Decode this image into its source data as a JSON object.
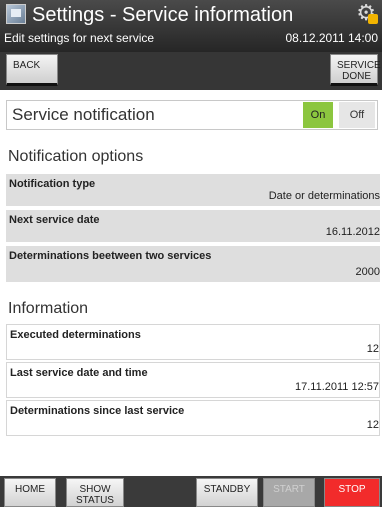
{
  "header": {
    "title": "Settings - Service information",
    "subtitle": "Edit settings for next service",
    "datetime": "08.12.2011 14:00"
  },
  "toolbar": {
    "back": "BACK",
    "service_done_line1": "SERVICE",
    "service_done_line2": "DONE"
  },
  "service_notification": {
    "label": "Service notification",
    "on": "On",
    "off": "Off",
    "state": "On"
  },
  "notification_options": {
    "heading": "Notification options",
    "rows": [
      {
        "label": "Notification type",
        "value": "Date or determinations"
      },
      {
        "label": "Next service date",
        "value": "16.11.2012"
      },
      {
        "label": "Determinations beetween two services",
        "value": "2000"
      }
    ]
  },
  "information": {
    "heading": "Information",
    "rows": [
      {
        "label": "Executed determinations",
        "value": "12"
      },
      {
        "label": "Last service date and time",
        "value": "17.11.2011 12:57"
      },
      {
        "label": "Determinations since last service",
        "value": "12"
      }
    ]
  },
  "footer": {
    "home": "HOME",
    "show_status_line1": "SHOW",
    "show_status_line2": "STATUS",
    "standby": "STANDBY",
    "start": "START",
    "stop": "STOP"
  },
  "colors": {
    "on_green": "#8cc63f",
    "stop_red": "#f22b2b",
    "header_dark": "#2f2f2f"
  },
  "icons": {
    "app": "settings-window-icon",
    "status": "gear-warning-icon"
  }
}
